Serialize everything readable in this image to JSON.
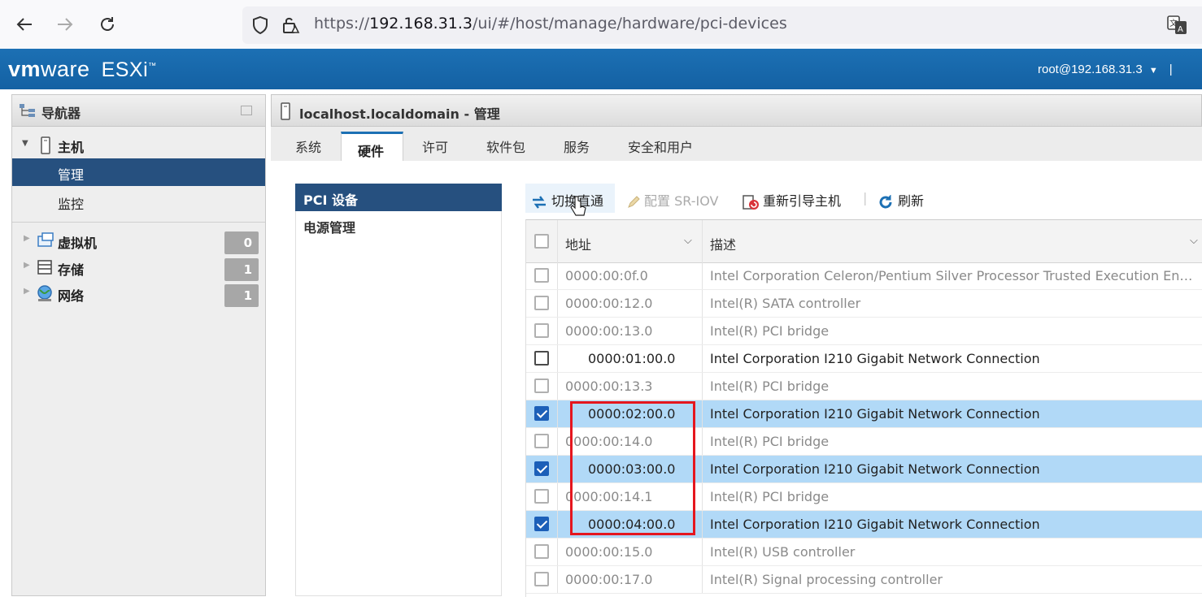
{
  "browser": {
    "url_prefix": "https://",
    "url_host": "192.168.31.3",
    "url_path": "/ui/#/host/manage/hardware/pci-devices"
  },
  "header": {
    "logo_vm": "vm",
    "logo_ware": "ware",
    "logo_product": "ESXi",
    "logo_tm": "™",
    "user": "root@192.168.31.3"
  },
  "navigator": {
    "title": "导航器",
    "host_label": "主机",
    "host_children": [
      "管理",
      "监控"
    ],
    "groups": [
      {
        "label": "虚拟机",
        "count": "0"
      },
      {
        "label": "存储",
        "count": "1"
      },
      {
        "label": "网络",
        "count": "1"
      }
    ]
  },
  "main": {
    "title": "localhost.localdomain - 管理",
    "tabs": [
      "系统",
      "硬件",
      "许可",
      "软件包",
      "服务",
      "安全和用户"
    ],
    "active_tab": "硬件",
    "side_items": [
      "PCI 设备",
      "电源管理"
    ],
    "toolbar": {
      "passthrough": "切换直通",
      "sriov": "配置 SR-IOV",
      "reboot": "重新引导主机",
      "refresh": "刷新"
    },
    "table": {
      "col_address": "地址",
      "col_description": "描述",
      "rows": [
        {
          "address": "0000:00:0f.0",
          "description": "Intel Corporation Celeron/Pentium Silver Processor Trusted Execution Engine…",
          "checked": false,
          "capable": false,
          "indent": false
        },
        {
          "address": "0000:00:12.0",
          "description": "Intel(R) SATA controller",
          "checked": false,
          "capable": false,
          "indent": false
        },
        {
          "address": "0000:00:13.0",
          "description": "Intel(R) PCI bridge",
          "checked": false,
          "capable": false,
          "indent": false
        },
        {
          "address": "0000:01:00.0",
          "description": "Intel Corporation I210 Gigabit Network Connection",
          "checked": false,
          "capable": true,
          "indent": true
        },
        {
          "address": "0000:00:13.3",
          "description": "Intel(R) PCI bridge",
          "checked": false,
          "capable": false,
          "indent": false
        },
        {
          "address": "0000:02:00.0",
          "description": "Intel Corporation I210 Gigabit Network Connection",
          "checked": true,
          "capable": true,
          "indent": true
        },
        {
          "address": "0000:00:14.0",
          "description": "Intel(R) PCI bridge",
          "checked": false,
          "capable": false,
          "indent": false
        },
        {
          "address": "0000:03:00.0",
          "description": "Intel Corporation I210 Gigabit Network Connection",
          "checked": true,
          "capable": true,
          "indent": true
        },
        {
          "address": "0000:00:14.1",
          "description": "Intel(R) PCI bridge",
          "checked": false,
          "capable": false,
          "indent": false
        },
        {
          "address": "0000:04:00.0",
          "description": "Intel Corporation I210 Gigabit Network Connection",
          "checked": true,
          "capable": true,
          "indent": true
        },
        {
          "address": "0000:00:15.0",
          "description": "Intel(R) USB controller",
          "checked": false,
          "capable": false,
          "indent": false
        },
        {
          "address": "0000:00:17.0",
          "description": "Intel(R) Signal processing controller",
          "checked": false,
          "capable": false,
          "indent": false
        }
      ]
    }
  },
  "colors": {
    "header_blue": "#1c70b4",
    "nav_selected": "#26507f",
    "row_selected": "#b1d9f7",
    "highlight_red": "#e5161e"
  }
}
